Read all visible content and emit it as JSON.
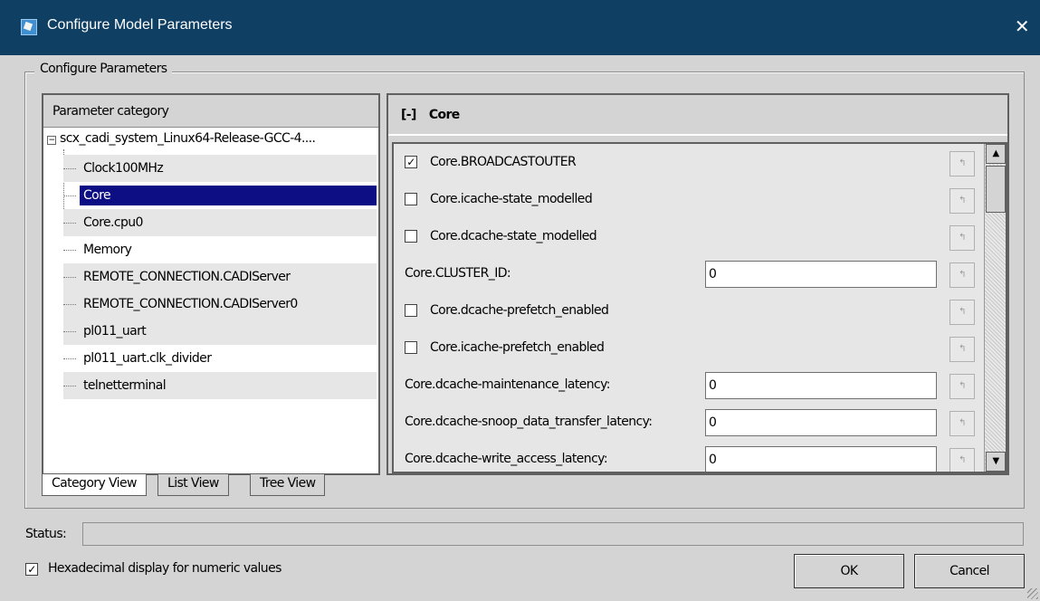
{
  "window": {
    "title": "Configure Model Parameters",
    "close_label": "✕"
  },
  "group_label": "Configure Parameters",
  "left": {
    "header": "Parameter category",
    "root": "scx_cadi_system_Linux64-Release-GCC-4....",
    "items": [
      "Clock100MHz",
      "Core",
      "Core.cpu0",
      "Memory",
      "REMOTE_CONNECTION.CADIServer",
      "REMOTE_CONNECTION.CADIServer0",
      "pl011_uart",
      "pl011_uart.clk_divider",
      "telnetterminal"
    ],
    "selected": "Core"
  },
  "tabs": [
    "Category View",
    "List View",
    "Tree View"
  ],
  "right": {
    "collapse": "[-]",
    "header": "Core",
    "params": [
      {
        "type": "check",
        "checked": true,
        "name": "Core.BROADCASTOUTER"
      },
      {
        "type": "check",
        "checked": false,
        "name": "Core.icache-state_modelled"
      },
      {
        "type": "check",
        "checked": false,
        "name": "Core.dcache-state_modelled"
      },
      {
        "type": "value",
        "name": "Core.CLUSTER_ID:",
        "value": "0"
      },
      {
        "type": "check",
        "checked": false,
        "name": "Core.dcache-prefetch_enabled"
      },
      {
        "type": "check",
        "checked": false,
        "name": "Core.icache-prefetch_enabled"
      },
      {
        "type": "value",
        "name": "Core.dcache-maintenance_latency:",
        "value": "0"
      },
      {
        "type": "value",
        "name": "Core.dcache-snoop_data_transfer_latency:",
        "value": "0"
      },
      {
        "type": "value",
        "name": "Core.dcache-write_access_latency:",
        "value": "0"
      }
    ],
    "reset_glyph": "↰"
  },
  "status": {
    "label": "Status:",
    "value": ""
  },
  "hex": {
    "checked": true,
    "label": "Hexadecimal display for numeric values"
  },
  "buttons": {
    "ok": "OK",
    "cancel": "Cancel"
  },
  "check_glyph": "✓"
}
